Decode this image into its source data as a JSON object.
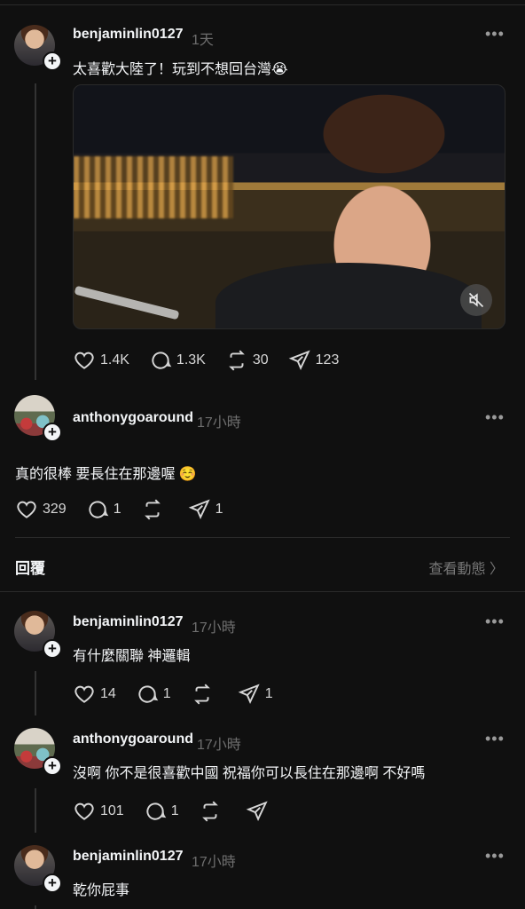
{
  "post": {
    "username": "benjaminlin0127",
    "time": "1天",
    "text": "太喜歡大陸了！玩到不想回台灣😭",
    "likes": "1.4K",
    "comments": "1.3K",
    "reposts": "30",
    "shares": "123"
  },
  "comment": {
    "username": "anthonygoaround",
    "time": "17小時",
    "text": "真的很棒 要長住在那邊喔 ☺️",
    "likes": "329",
    "comments": "1",
    "shares": "1"
  },
  "replies_header": {
    "title": "回覆",
    "view_activity": "查看動態 〉"
  },
  "replies": [
    {
      "username": "benjaminlin0127",
      "time": "17小時",
      "text": "有什麼關聯 神邏輯",
      "likes": "14",
      "comments": "1",
      "shares": "1"
    },
    {
      "username": "anthonygoaround",
      "time": "17小時",
      "text": "沒啊 你不是很喜歡中國 祝福你可以長住在那邊啊 不好嗎",
      "likes": "101",
      "comments": "1"
    },
    {
      "username": "benjaminlin0127",
      "time": "17小時",
      "text": "乾你屁事"
    }
  ]
}
